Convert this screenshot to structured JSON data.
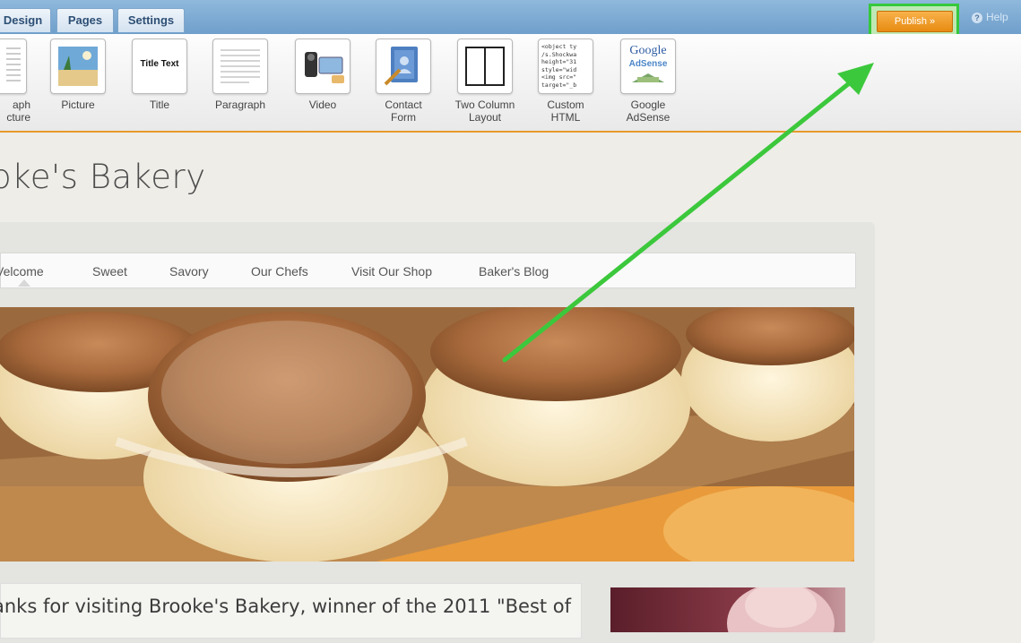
{
  "tabs": [
    "Design",
    "Pages",
    "Settings"
  ],
  "publish_label": "Publish »",
  "help_label": "Help",
  "toolbar": {
    "items": [
      {
        "label": "aph\ncture",
        "icon": "paragraph-picture-icon"
      },
      {
        "label": "Picture",
        "icon": "picture-icon"
      },
      {
        "label": "Title",
        "icon": "title-icon",
        "icon_text": "Title Text"
      },
      {
        "label": "Paragraph",
        "icon": "paragraph-icon"
      },
      {
        "label": "Video",
        "icon": "video-icon"
      },
      {
        "label": "Contact\nForm",
        "icon": "contact-form-icon"
      },
      {
        "label": "Two Column\nLayout",
        "icon": "two-column-icon"
      },
      {
        "label": "Custom\nHTML",
        "icon": "custom-html-icon",
        "icon_text": "<object ty\n/s.Shockwa\nheight=\"31\nstyle=\"wid\n<img src=\"\ntarget=\"_b"
      },
      {
        "label": "Google\nAdSense",
        "icon": "google-adsense-icon",
        "icon_text_1": "Google",
        "icon_text_2": "AdSense"
      }
    ]
  },
  "site": {
    "title": "oke's Bakery",
    "nav": [
      "Velcome",
      "Sweet",
      "Savory",
      "Our Chefs",
      "Visit Our Shop",
      "Baker's Blog"
    ],
    "intro": "anks for visiting Brooke's Bakery, winner of the 2011 \"Best of"
  },
  "colors": {
    "accent_orange": "#e79a2c",
    "highlight_green": "#35c83c",
    "tab_blue": "#6f9fcb"
  }
}
